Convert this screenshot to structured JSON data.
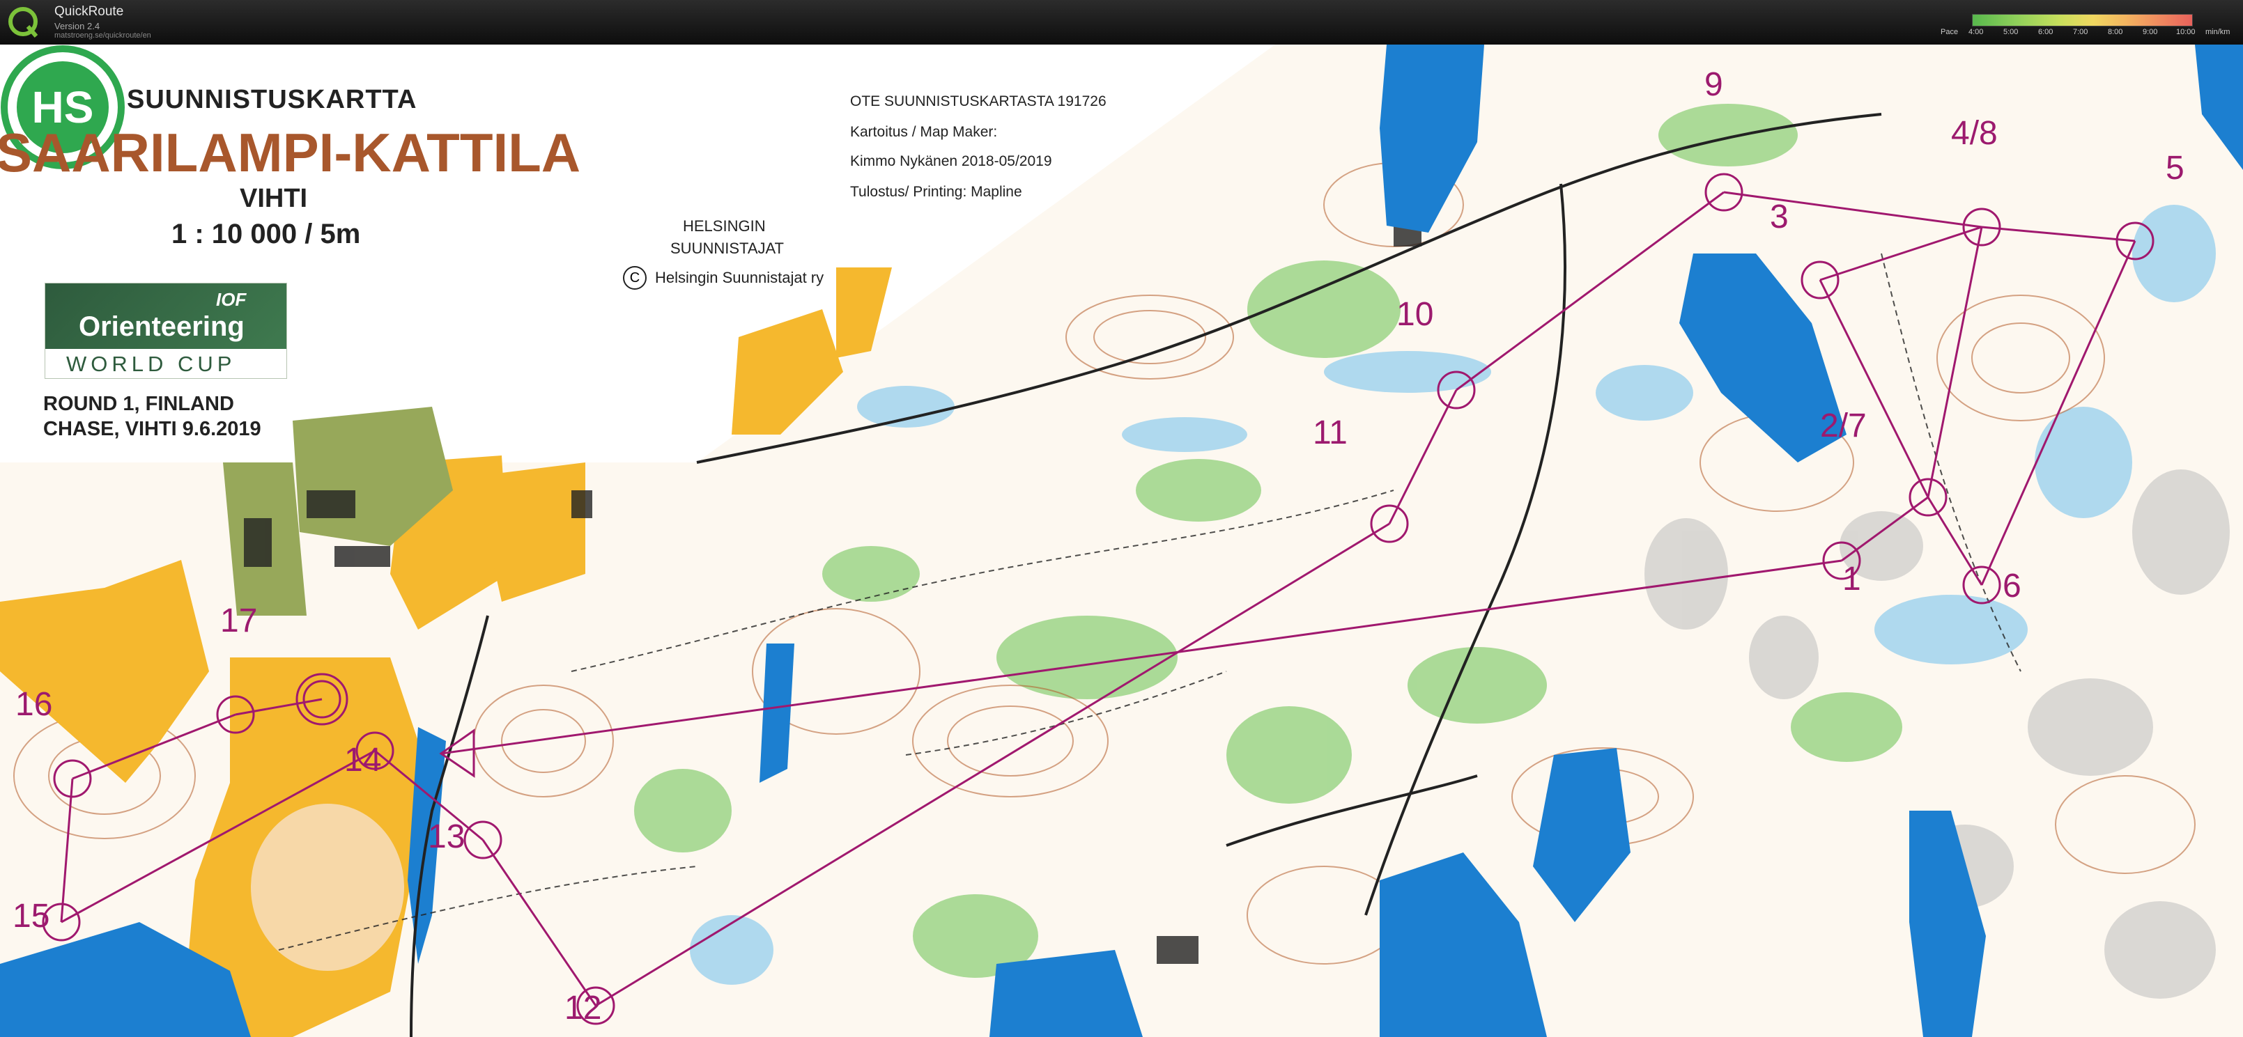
{
  "window": {
    "app_name": "QuickRoute",
    "version": "Version 2.4",
    "url": "matstroeng.se/quickroute/en"
  },
  "pace_legend": {
    "label": "Pace",
    "ticks": [
      "4:00",
      "5:00",
      "6:00",
      "7:00",
      "8:00",
      "9:00",
      "10:00"
    ],
    "unit": "min/km"
  },
  "map": {
    "subtitle": "SUUNNISTUSKARTTA",
    "title": "SAARILAMPI-KATTILA",
    "region": "VIHTI",
    "scale": "1 : 10 000  /  5m",
    "event_line1": "ROUND 1, FINLAND",
    "event_line2": "CHASE, VIHTI 9.6.2019",
    "credit_1": "OTE SUUNNISTUSKARTASTA 191726",
    "credit_2": "Kartoitus / Map Maker:",
    "credit_3": "Kimmo Nykänen 2018-05/2019",
    "credit_4": "Tulostus/ Printing: Mapline",
    "club_name_1": "HELSINGIN",
    "club_name_2": "SUUNNISTAJAT",
    "copyright_symbol": "C",
    "copyright": "Helsingin Suunnistajat ry",
    "club_logo_letters": "HS",
    "owc_word1": "Orienteering",
    "owc_word2": "WORLD CUP",
    "owc_iof": "IOF"
  },
  "controls": [
    {
      "label": "1"
    },
    {
      "label": "2/7"
    },
    {
      "label": "3"
    },
    {
      "label": "4/8"
    },
    {
      "label": "5"
    },
    {
      "label": "6"
    },
    {
      "label": "9"
    },
    {
      "label": "10"
    },
    {
      "label": "11"
    },
    {
      "label": "12"
    },
    {
      "label": "13"
    },
    {
      "label": "14"
    },
    {
      "label": "15"
    },
    {
      "label": "16"
    },
    {
      "label": "17"
    }
  ],
  "colors": {
    "course": "#a0186e",
    "water": "#1c7fd0",
    "open_land": "#f5b82e",
    "forest_green": "#7fc66b",
    "contours": "#b35b2a",
    "marsh": "#3aa0d8"
  }
}
